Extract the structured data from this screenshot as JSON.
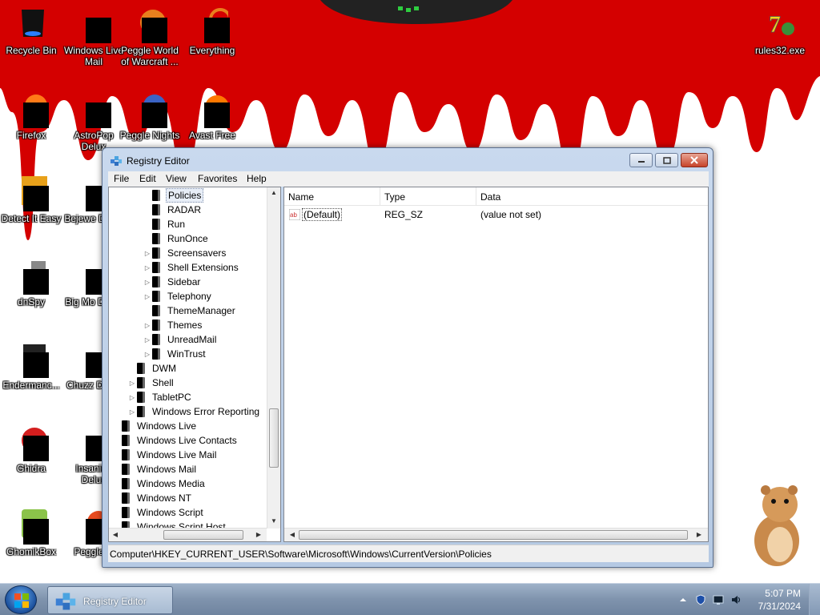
{
  "desktop": {
    "icons": [
      {
        "label": "Recycle Bin",
        "icon": "recycle-bin-icon"
      },
      {
        "label": "Windows Live Mail",
        "icon": "windows-live-mail-icon"
      },
      {
        "label": "Peggle World of Warcraft ...",
        "icon": "peggle-wow-icon"
      },
      {
        "label": "Everything",
        "icon": "everything-icon"
      },
      {
        "label": "rules32.exe",
        "icon": "rules32-icon"
      },
      {
        "label": "Firefox",
        "icon": "firefox-icon"
      },
      {
        "label": "AstroPop Delux",
        "icon": "astropop-icon"
      },
      {
        "label": "Peggle Nights",
        "icon": "peggle-nights-icon"
      },
      {
        "label": "Avast Free",
        "icon": "avast-icon"
      },
      {
        "label": "Detect It Easy",
        "icon": "detect-it-easy-icon"
      },
      {
        "label": "Bejewe Delux",
        "icon": "bejeweled-icon"
      },
      {
        "label": "dnSpy",
        "icon": "dnspy-icon"
      },
      {
        "label": "Big Mo Delux",
        "icon": "big-money-icon"
      },
      {
        "label": "Endermanc...",
        "icon": "enderman-icon"
      },
      {
        "label": "Chuzz Delux",
        "icon": "chuzzle-icon"
      },
      {
        "label": "Ghidra",
        "icon": "ghidra-icon"
      },
      {
        "label": "Insaniqu Delux",
        "icon": "insaniquarium-icon"
      },
      {
        "label": "GhomikBox",
        "icon": "ghomikbox-icon"
      },
      {
        "label": "Peggle D",
        "icon": "peggle-deluxe-icon"
      }
    ]
  },
  "window": {
    "title": "Registry Editor",
    "menu": [
      "File",
      "Edit",
      "View",
      "Favorites",
      "Help"
    ],
    "tree": [
      {
        "label": "Policies",
        "depth": 2,
        "expander": "none",
        "selected": true
      },
      {
        "label": "RADAR",
        "depth": 2,
        "expander": "none"
      },
      {
        "label": "Run",
        "depth": 2,
        "expander": "none"
      },
      {
        "label": "RunOnce",
        "depth": 2,
        "expander": "none"
      },
      {
        "label": "Screensavers",
        "depth": 2,
        "expander": "collapsed"
      },
      {
        "label": "Shell Extensions",
        "depth": 2,
        "expander": "collapsed"
      },
      {
        "label": "Sidebar",
        "depth": 2,
        "expander": "collapsed"
      },
      {
        "label": "Telephony",
        "depth": 2,
        "expander": "collapsed"
      },
      {
        "label": "ThemeManager",
        "depth": 2,
        "expander": "none"
      },
      {
        "label": "Themes",
        "depth": 2,
        "expander": "collapsed"
      },
      {
        "label": "UnreadMail",
        "depth": 2,
        "expander": "collapsed"
      },
      {
        "label": "WinTrust",
        "depth": 2,
        "expander": "collapsed"
      },
      {
        "label": "DWM",
        "depth": 1,
        "expander": "none"
      },
      {
        "label": "Shell",
        "depth": 1,
        "expander": "collapsed"
      },
      {
        "label": "TabletPC",
        "depth": 1,
        "expander": "collapsed"
      },
      {
        "label": "Windows Error Reporting",
        "depth": 1,
        "expander": "collapsed"
      },
      {
        "label": "Windows Live",
        "depth": 0,
        "expander": "none"
      },
      {
        "label": "Windows Live Contacts",
        "depth": 0,
        "expander": "none"
      },
      {
        "label": "Windows Live Mail",
        "depth": 0,
        "expander": "none"
      },
      {
        "label": "Windows Mail",
        "depth": 0,
        "expander": "none"
      },
      {
        "label": "Windows Media",
        "depth": 0,
        "expander": "none"
      },
      {
        "label": "Windows NT",
        "depth": 0,
        "expander": "none"
      },
      {
        "label": "Windows Script",
        "depth": 0,
        "expander": "none"
      },
      {
        "label": "Windows Script Host",
        "depth": 0,
        "expander": "none"
      }
    ],
    "columns": {
      "name": "Name",
      "type": "Type",
      "data": "Data"
    },
    "values": [
      {
        "name": "(Default)",
        "type": "REG_SZ",
        "data": "(value not set)"
      }
    ],
    "status_path": "Computer\\HKEY_CURRENT_USER\\Software\\Microsoft\\Windows\\CurrentVersion\\Policies"
  },
  "taskbar": {
    "task_label": "Registry Editor",
    "time": "5:07 PM",
    "date": "7/31/2024"
  },
  "colors": {
    "wallpaper_red": "#d40000",
    "taskbar": "#8298b4"
  }
}
